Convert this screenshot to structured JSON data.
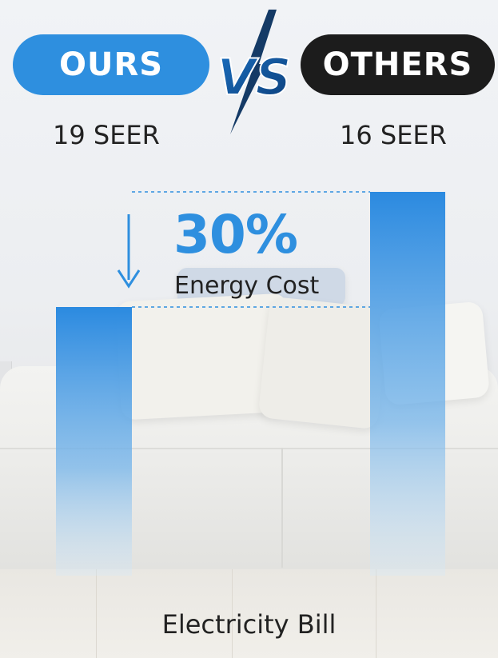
{
  "header": {
    "left_label": "OURS",
    "right_label": "OTHERS",
    "vs_label": "VS"
  },
  "ratings": {
    "ours": "19 SEER",
    "others": "16 SEER"
  },
  "annotation": {
    "percent": "30%",
    "label": "Energy Cost"
  },
  "colors": {
    "accent_blue": "#2e8fdf",
    "dark": "#1c1c1c"
  },
  "chart_data": {
    "type": "bar",
    "title": "",
    "xlabel": "Electricity Bill",
    "ylabel": "",
    "categories": [
      "OURS",
      "OTHERS"
    ],
    "values": [
      70,
      100
    ],
    "ylim": [
      0,
      100
    ],
    "grid": false,
    "annotation": "30% Energy Cost"
  }
}
